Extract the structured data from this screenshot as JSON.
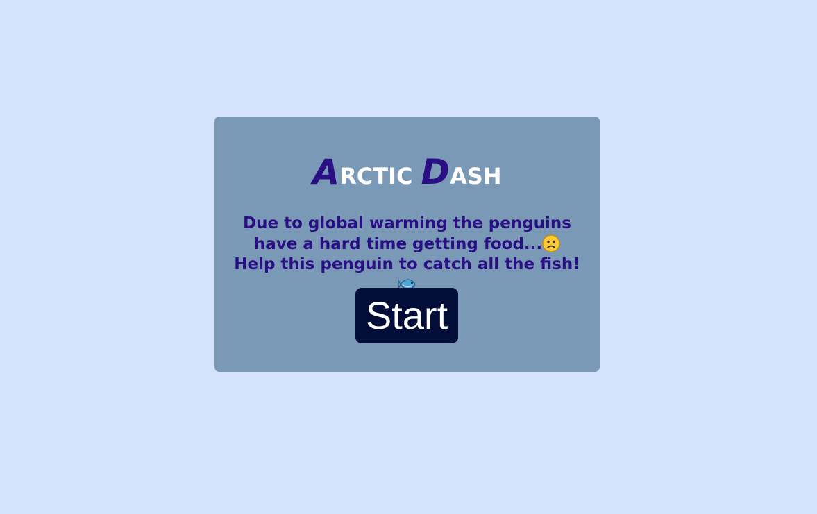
{
  "game": {
    "title_first_initial": "A",
    "title_first_rest": "RCTIC",
    "title_second_initial": "D",
    "title_second_rest": "ASH",
    "description_part1": "Due to global warming the penguins have a hard time getting food...",
    "description_part2": " Help this penguin to catch all the fish!",
    "start_label": "Start"
  },
  "icons": {
    "sad_face": "sad-face-icon",
    "fish": "fish-icon"
  },
  "colors": {
    "page_background": "#d4e2fb",
    "card_background": "#7a99b6",
    "title_accent": "#2a0f84",
    "title_white": "#ffffff",
    "text": "#2a0f84",
    "button_background": "#020d38",
    "button_text": "#ffffff"
  }
}
